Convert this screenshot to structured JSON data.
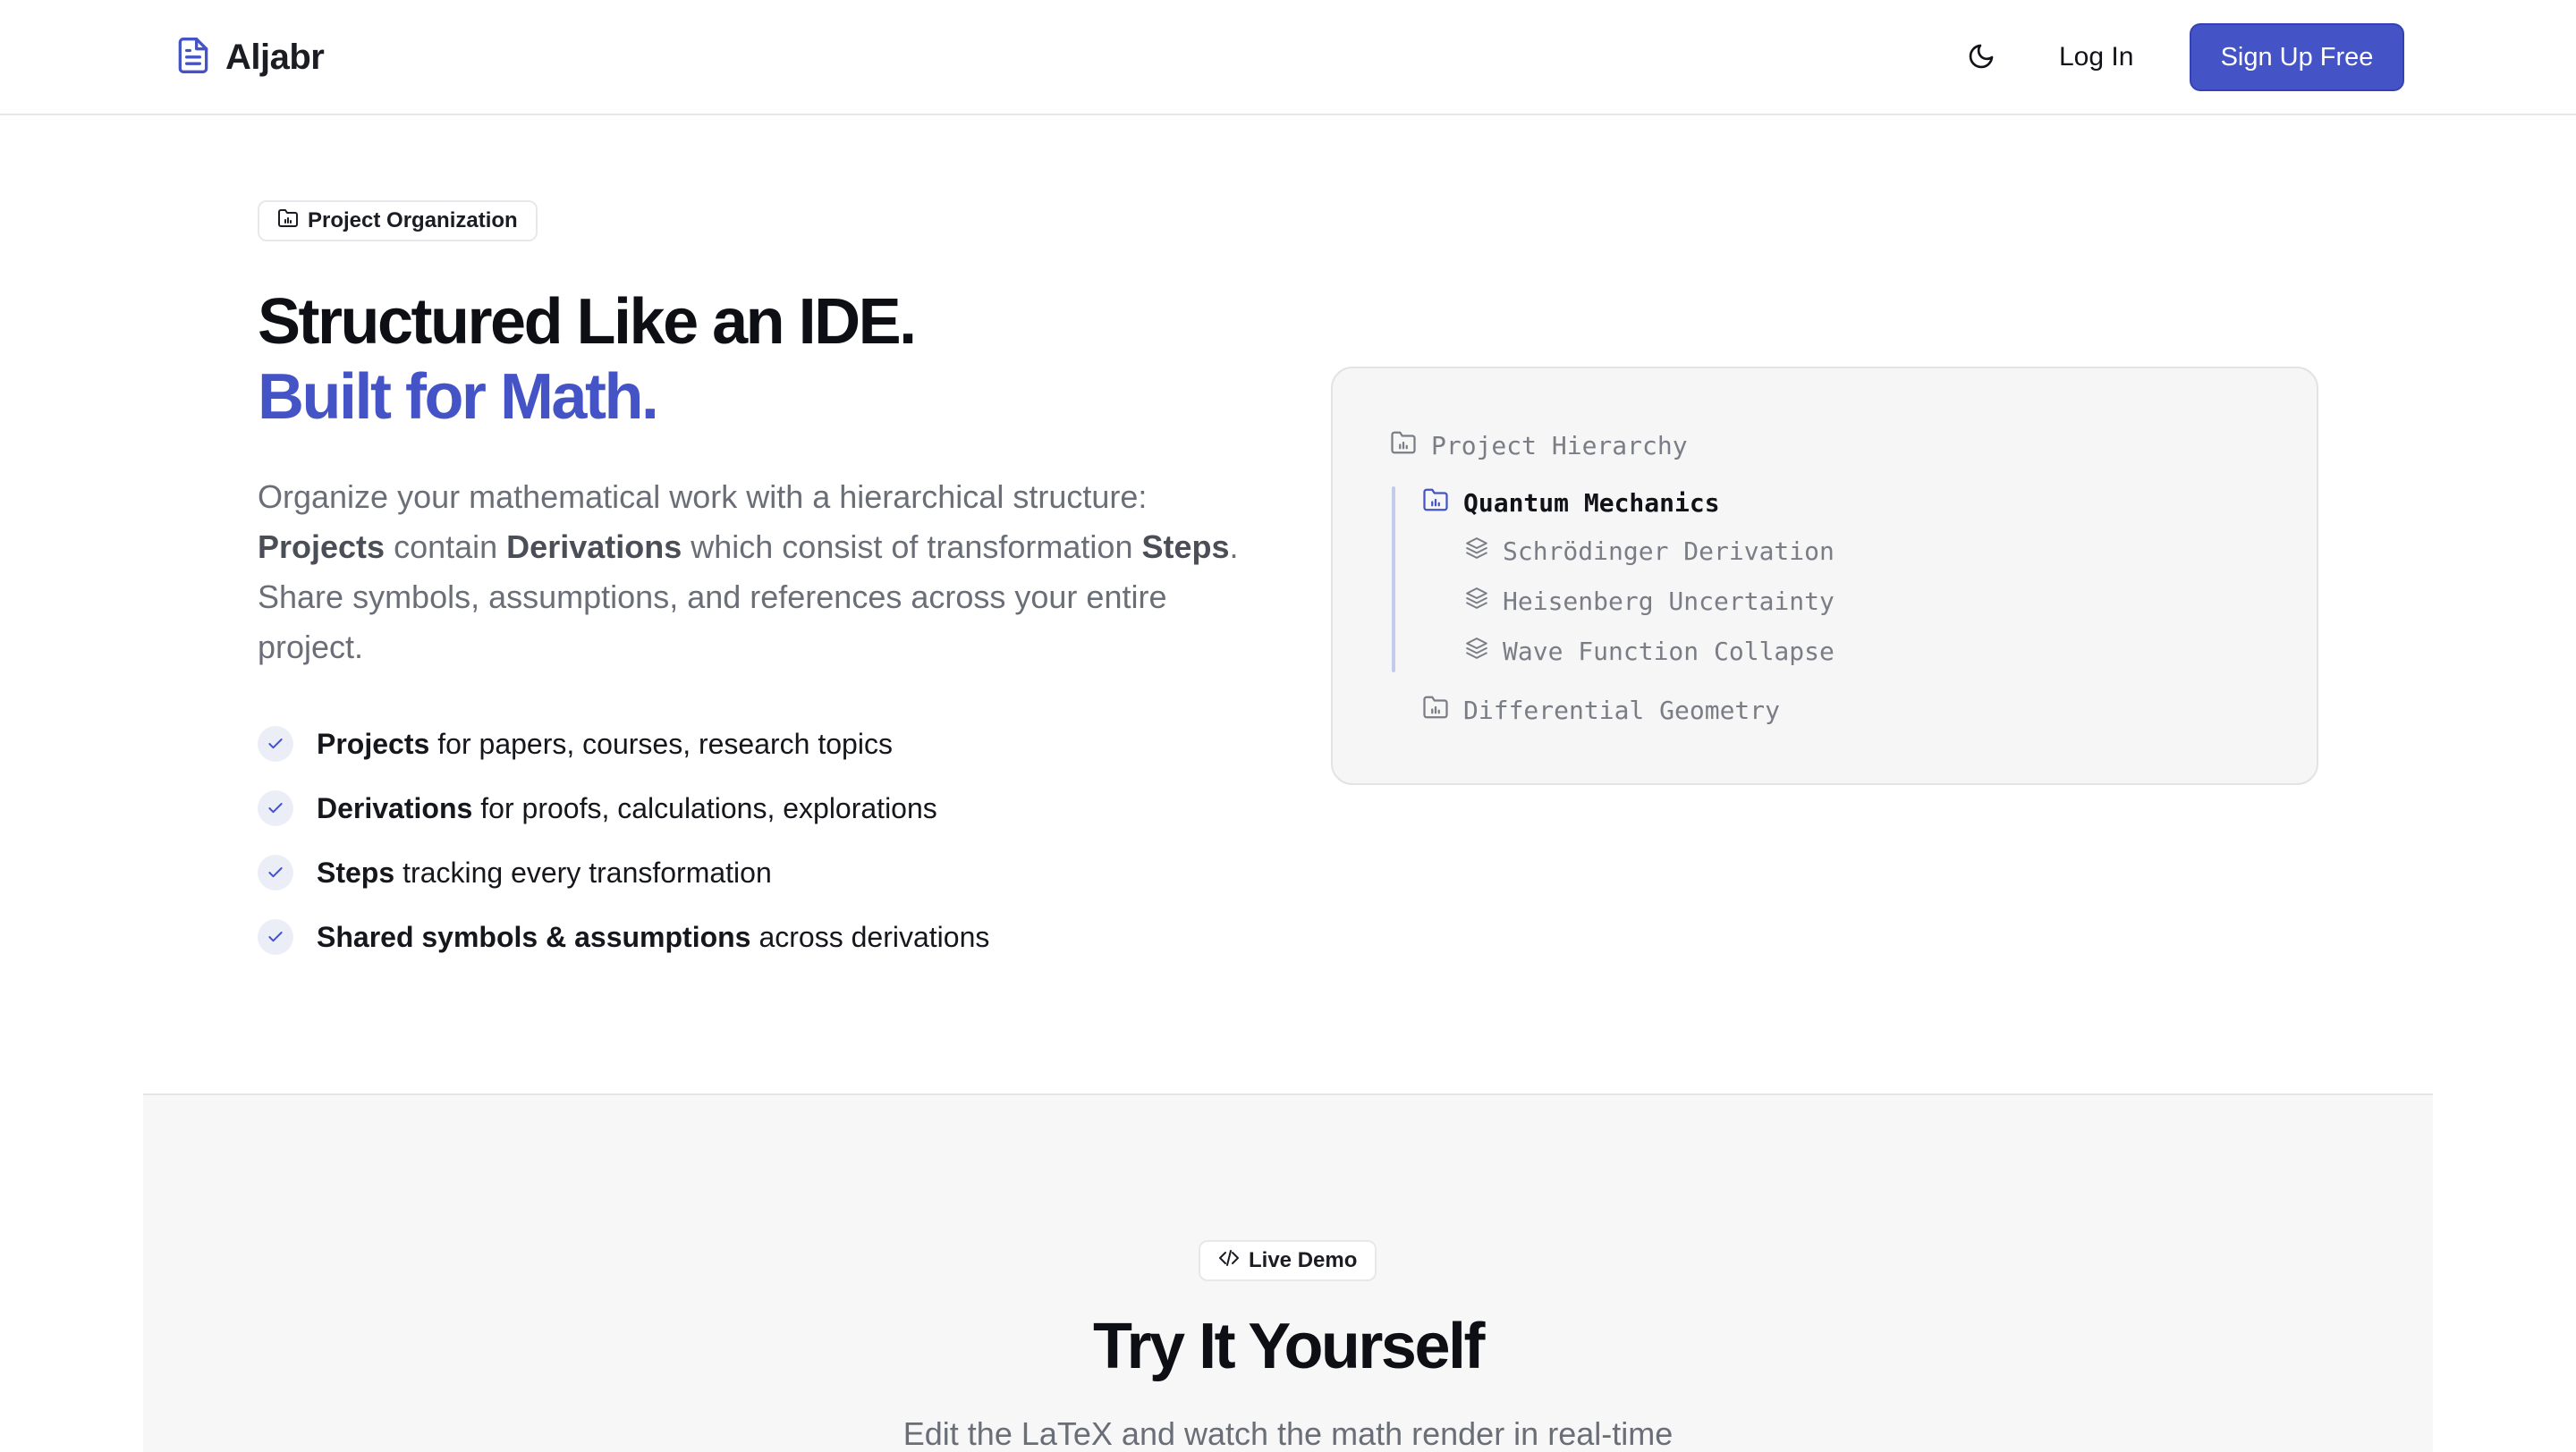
{
  "header": {
    "brand": "Aljabr",
    "login_label": "Log In",
    "signup_label": "Sign Up Free"
  },
  "hero": {
    "badge": "Project Organization",
    "title_line1": "Structured Like an IDE.",
    "title_line2": "Built for Math.",
    "description": {
      "intro": "Organize your mathematical work with a hierarchical structure: ",
      "projects": "Projects",
      "contain": " contain ",
      "derivations": "Derivations",
      "consist": " which consist of transformation ",
      "steps": "Steps",
      "outro": ". Share symbols, assumptions, and references across your entire project."
    },
    "features": [
      {
        "bold": "Projects",
        "rest": "for papers, courses, research topics"
      },
      {
        "bold": "Derivations",
        "rest": "for proofs, calculations, explorations"
      },
      {
        "bold": "Steps",
        "rest": "tracking every transformation"
      },
      {
        "bold": "Shared symbols & assumptions",
        "rest": "across derivations"
      }
    ]
  },
  "hierarchy": {
    "title": "Project Hierarchy",
    "project_open": "Quantum Mechanics",
    "derivations": [
      "Schrödinger Derivation",
      "Heisenberg Uncertainty",
      "Wave Function Collapse"
    ],
    "project_closed": "Differential Geometry"
  },
  "demo": {
    "badge": "Live Demo",
    "title": "Try It Yourself",
    "subtitle": "Edit the LaTeX and watch the math render in real-time"
  },
  "colors": {
    "accent": "#4453c6",
    "text": "#111318",
    "muted": "#6a6e77",
    "panel_bg": "#f6f6f7"
  },
  "icons": [
    "document-icon",
    "moon-icon",
    "folder-icon",
    "check-icon",
    "layers-icon",
    "code-icon"
  ]
}
